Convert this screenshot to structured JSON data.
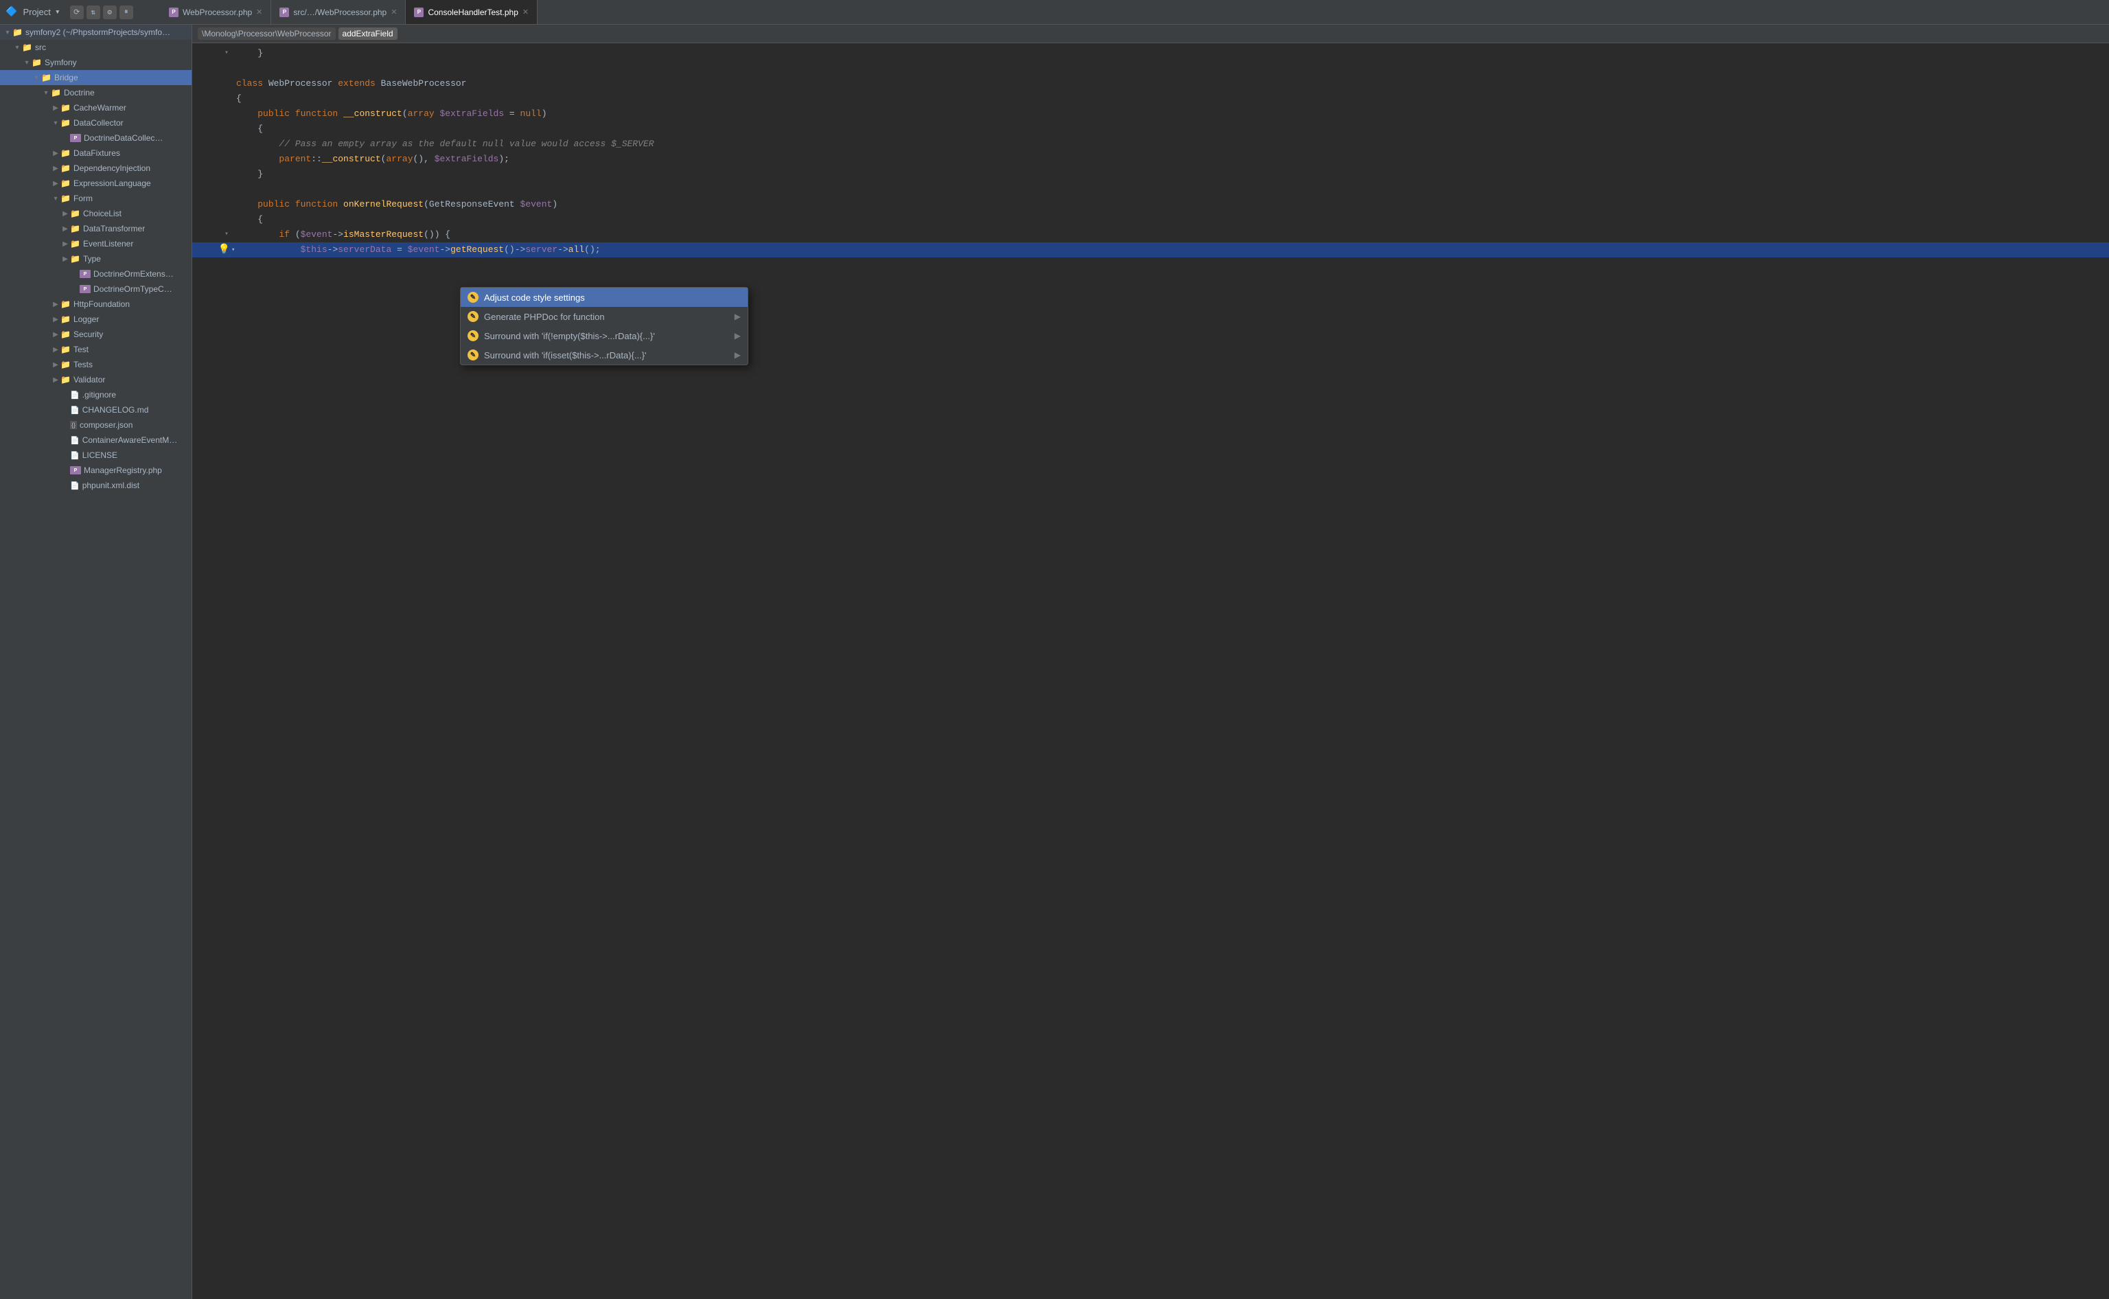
{
  "titlebar": {
    "project_name": "Project",
    "dropdown_arrow": "▾",
    "icons": [
      "⟳",
      "⇅",
      "⚙",
      "⏸"
    ]
  },
  "tabs": [
    {
      "id": "tab1",
      "label": "WebProcessor.php",
      "active": false,
      "has_close": true
    },
    {
      "id": "tab2",
      "label": "src/…/WebProcessor.php",
      "active": false,
      "has_close": true
    },
    {
      "id": "tab3",
      "label": "ConsoleHandlerTest.php",
      "active": true,
      "has_close": true
    }
  ],
  "breadcrumb": {
    "items": [
      {
        "label": "\\Monolog\\Processor\\WebProcessor",
        "active": false
      },
      {
        "label": "addExtraField",
        "active": true
      }
    ]
  },
  "sidebar": {
    "title": "Project",
    "items": [
      {
        "indent": 0,
        "type": "root",
        "label": "symfony2 (~/PhpstormProjects/symfo…",
        "arrow": "▾",
        "icon": "folder"
      },
      {
        "indent": 1,
        "type": "folder",
        "label": "src",
        "arrow": "▾",
        "icon": "folder"
      },
      {
        "indent": 2,
        "type": "folder",
        "label": "Symfony",
        "arrow": "▾",
        "icon": "folder"
      },
      {
        "indent": 3,
        "type": "folder",
        "label": "Bridge",
        "arrow": "▾",
        "icon": "folder",
        "selected": true
      },
      {
        "indent": 4,
        "type": "folder",
        "label": "Doctrine",
        "arrow": "▾",
        "icon": "folder"
      },
      {
        "indent": 5,
        "type": "folder",
        "label": "CacheWarmer",
        "arrow": "▶",
        "icon": "folder"
      },
      {
        "indent": 5,
        "type": "folder",
        "label": "DataCollector",
        "arrow": "▾",
        "icon": "folder"
      },
      {
        "indent": 6,
        "type": "file",
        "label": "DoctrineDataCollec…",
        "icon": "php"
      },
      {
        "indent": 5,
        "type": "folder",
        "label": "DataFixtures",
        "arrow": "▶",
        "icon": "folder"
      },
      {
        "indent": 5,
        "type": "folder",
        "label": "DependencyInjection",
        "arrow": "▶",
        "icon": "folder"
      },
      {
        "indent": 5,
        "type": "folder",
        "label": "ExpressionLanguage",
        "arrow": "▶",
        "icon": "folder"
      },
      {
        "indent": 5,
        "type": "folder",
        "label": "Form",
        "arrow": "▾",
        "icon": "folder"
      },
      {
        "indent": 6,
        "type": "folder",
        "label": "ChoiceList",
        "arrow": "▶",
        "icon": "folder"
      },
      {
        "indent": 6,
        "type": "folder",
        "label": "DataTransformer",
        "arrow": "▶",
        "icon": "folder"
      },
      {
        "indent": 6,
        "type": "folder",
        "label": "EventListener",
        "arrow": "▶",
        "icon": "folder"
      },
      {
        "indent": 6,
        "type": "folder",
        "label": "Type",
        "arrow": "▶",
        "icon": "folder"
      },
      {
        "indent": 6,
        "type": "file",
        "label": "DoctrineOrmExtens…",
        "icon": "php"
      },
      {
        "indent": 6,
        "type": "file",
        "label": "DoctrineOrmTypeC…",
        "icon": "php"
      },
      {
        "indent": 5,
        "type": "folder",
        "label": "HttpFoundation",
        "arrow": "▶",
        "icon": "folder"
      },
      {
        "indent": 5,
        "type": "folder",
        "label": "Logger",
        "arrow": "▶",
        "icon": "folder"
      },
      {
        "indent": 5,
        "type": "folder",
        "label": "Security",
        "arrow": "▶",
        "icon": "folder"
      },
      {
        "indent": 5,
        "type": "folder",
        "label": "Test",
        "arrow": "▶",
        "icon": "folder"
      },
      {
        "indent": 5,
        "type": "folder",
        "label": "Tests",
        "arrow": "▶",
        "icon": "folder"
      },
      {
        "indent": 5,
        "type": "folder",
        "label": "Validator",
        "arrow": "▶",
        "icon": "folder"
      },
      {
        "indent": 5,
        "type": "file_text",
        "label": ".gitignore",
        "icon": "text"
      },
      {
        "indent": 5,
        "type": "file_text",
        "label": "CHANGELOG.md",
        "icon": "text"
      },
      {
        "indent": 5,
        "type": "file_json",
        "label": "composer.json",
        "icon": "json"
      },
      {
        "indent": 5,
        "type": "file_text",
        "label": "ContainerAwareEventM…",
        "icon": "text"
      },
      {
        "indent": 5,
        "type": "file_text",
        "label": "LICENSE",
        "icon": "text"
      },
      {
        "indent": 5,
        "type": "file",
        "label": "ManagerRegistry.php",
        "icon": "php"
      },
      {
        "indent": 5,
        "type": "file_text",
        "label": "phpunit.xml.dist",
        "icon": "text"
      }
    ]
  },
  "code": {
    "lines": [
      {
        "num": "",
        "content": "    }",
        "tokens": [
          {
            "text": "    }",
            "cls": "plain"
          }
        ]
      },
      {
        "num": "",
        "content": "",
        "tokens": []
      },
      {
        "num": "",
        "content": "class WebProcessor extends BaseWebProcessor",
        "tokens": [
          {
            "text": "class ",
            "cls": "kw"
          },
          {
            "text": "WebProcessor ",
            "cls": "cls"
          },
          {
            "text": "extends ",
            "cls": "kw"
          },
          {
            "text": "BaseWebProcessor",
            "cls": "cls"
          }
        ]
      },
      {
        "num": "",
        "content": "{",
        "tokens": [
          {
            "text": "{",
            "cls": "brace"
          }
        ]
      },
      {
        "num": "",
        "content": "    public function __construct(array $extraFields = null)",
        "tokens": [
          {
            "text": "    ",
            "cls": "plain"
          },
          {
            "text": "public ",
            "cls": "kw"
          },
          {
            "text": "function ",
            "cls": "kw"
          },
          {
            "text": "__construct",
            "cls": "fn"
          },
          {
            "text": "(",
            "cls": "plain"
          },
          {
            "text": "array ",
            "cls": "kw"
          },
          {
            "text": "$extraFields",
            "cls": "var"
          },
          {
            "text": " = ",
            "cls": "plain"
          },
          {
            "text": "null",
            "cls": "kw"
          },
          {
            "text": ")",
            "cls": "plain"
          }
        ]
      },
      {
        "num": "",
        "content": "    {",
        "tokens": [
          {
            "text": "    {",
            "cls": "plain"
          }
        ]
      },
      {
        "num": "",
        "content": "        // Pass an empty array as the default null value would access $_SERVER",
        "tokens": [
          {
            "text": "        // Pass an empty array as the default null value would access $_SERVER",
            "cls": "comment"
          }
        ]
      },
      {
        "num": "",
        "content": "        parent::__construct(array(), $extraFields);",
        "tokens": [
          {
            "text": "        ",
            "cls": "plain"
          },
          {
            "text": "parent",
            "cls": "kw"
          },
          {
            "text": "::",
            "cls": "plain"
          },
          {
            "text": "__construct",
            "cls": "fn"
          },
          {
            "text": "(",
            "cls": "plain"
          },
          {
            "text": "array",
            "cls": "kw"
          },
          {
            "text": "(), ",
            "cls": "plain"
          },
          {
            "text": "$extraFields",
            "cls": "var"
          },
          {
            "text": ");",
            "cls": "plain"
          }
        ]
      },
      {
        "num": "",
        "content": "    }",
        "tokens": [
          {
            "text": "    }",
            "cls": "plain"
          }
        ]
      },
      {
        "num": "",
        "content": "",
        "tokens": []
      },
      {
        "num": "",
        "content": "    public function onKernelRequest(GetResponseEvent $event)",
        "tokens": [
          {
            "text": "    ",
            "cls": "plain"
          },
          {
            "text": "public ",
            "cls": "kw"
          },
          {
            "text": "function ",
            "cls": "kw"
          },
          {
            "text": "onKernelRequest",
            "cls": "fn"
          },
          {
            "text": "(",
            "cls": "plain"
          },
          {
            "text": "GetResponseEvent ",
            "cls": "cls"
          },
          {
            "text": "$event",
            "cls": "var"
          },
          {
            "text": ")",
            "cls": "plain"
          }
        ]
      },
      {
        "num": "",
        "content": "    {",
        "tokens": [
          {
            "text": "    {",
            "cls": "plain"
          }
        ]
      },
      {
        "num": "",
        "content": "        if ($event->isMasterRequest()) {",
        "tokens": [
          {
            "text": "        ",
            "cls": "plain"
          },
          {
            "text": "if ",
            "cls": "kw"
          },
          {
            "text": "(",
            "cls": "plain"
          },
          {
            "text": "$event",
            "cls": "var"
          },
          {
            "text": "->",
            "cls": "plain"
          },
          {
            "text": "isMasterRequest",
            "cls": "fn"
          },
          {
            "text": "()) {",
            "cls": "plain"
          }
        ]
      },
      {
        "num": "",
        "content": "            $this->serverData = $event->getRequest()->server->all();",
        "highlight": true,
        "tokens": [
          {
            "text": "            ",
            "cls": "plain"
          },
          {
            "text": "$this",
            "cls": "var"
          },
          {
            "text": "->",
            "cls": "plain"
          },
          {
            "text": "serverData",
            "cls": "var"
          },
          {
            "text": " = ",
            "cls": "plain"
          },
          {
            "text": "$event",
            "cls": "var"
          },
          {
            "text": "->",
            "cls": "plain"
          },
          {
            "text": "getRequest",
            "cls": "fn"
          },
          {
            "text": "()->",
            "cls": "plain"
          },
          {
            "text": "server",
            "cls": "var"
          },
          {
            "text": "->",
            "cls": "plain"
          },
          {
            "text": "all",
            "cls": "fn"
          },
          {
            "text": "();",
            "cls": "plain"
          }
        ]
      }
    ]
  },
  "intention_popup": {
    "items": [
      {
        "id": "item1",
        "label": "Adjust code style settings",
        "selected": true,
        "has_arrow": false
      },
      {
        "id": "item2",
        "label": "Generate PHPDoc for function",
        "selected": false,
        "has_arrow": true
      },
      {
        "id": "item3",
        "label": "Surround with 'if(!empty($this->...rData){...}'",
        "selected": false,
        "has_arrow": true
      },
      {
        "id": "item4",
        "label": "Surround with 'if(isset($this->...rData){...}'",
        "selected": false,
        "has_arrow": true
      }
    ]
  }
}
